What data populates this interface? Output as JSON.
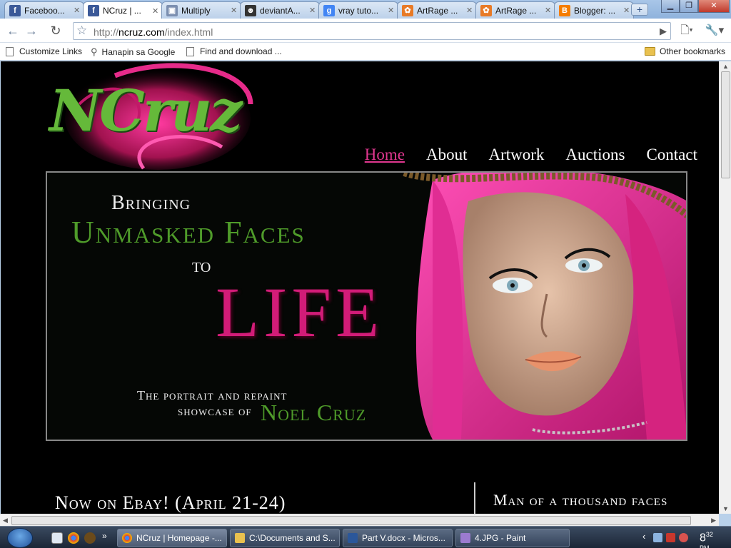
{
  "browser": {
    "tabs": [
      {
        "title": "Faceboo...",
        "icon": "facebook-icon",
        "active": false
      },
      {
        "title": "NCruz | ...",
        "icon": "facebook-icon",
        "active": true
      },
      {
        "title": "Multiply",
        "icon": "multiply-icon",
        "active": false
      },
      {
        "title": "deviantA...",
        "icon": "deviantart-icon",
        "active": false
      },
      {
        "title": "vray tuto...",
        "icon": "google-icon",
        "active": false
      },
      {
        "title": "ArtRage ...",
        "icon": "artrage-icon",
        "active": false
      },
      {
        "title": "ArtRage ...",
        "icon": "artrage-icon",
        "active": false
      },
      {
        "title": "Blogger: ...",
        "icon": "blogger-icon",
        "active": false
      }
    ],
    "url_prefix": "http://",
    "url_domain": "ncruz.com",
    "url_path": "/index.html",
    "bookmarks": [
      {
        "label": "Customize Links",
        "icon": "page-icon"
      },
      {
        "label": "Hanapin sa Google",
        "icon": "search-icon"
      },
      {
        "label": "Find and download ...",
        "icon": "page-icon"
      }
    ],
    "other_bookmarks": "Other bookmarks"
  },
  "page": {
    "logo": "NCruz",
    "nav": [
      {
        "label": "Home",
        "active": true
      },
      {
        "label": "About",
        "active": false
      },
      {
        "label": "Artwork",
        "active": false
      },
      {
        "label": "Auctions",
        "active": false
      },
      {
        "label": "Contact",
        "active": false
      }
    ],
    "banner": {
      "line1": "Bringing",
      "line2": "Unmasked Faces",
      "line3": "to",
      "line4": "LIFE",
      "line5": "The portrait and repaint",
      "line6": "showcase of",
      "line7": "Noel Cruz"
    },
    "section_left": "Now on Ebay! (April 21-24)",
    "section_right": "Man of a thousand faces"
  },
  "taskbar": {
    "tasks": [
      {
        "label": "NCruz | Homepage -...",
        "icon": "chrome-icon"
      },
      {
        "label": "C:\\Documents and S...",
        "icon": "folder-icon"
      },
      {
        "label": "Part V.docx - Micros...",
        "icon": "word-icon"
      },
      {
        "label": "4.JPG - Paint",
        "icon": "paint-icon"
      }
    ],
    "clock_hour": "8",
    "clock_min": "32",
    "clock_ampm": "PM"
  },
  "colors": {
    "accent_pink": "#d21c78",
    "accent_green": "#4f9b2a",
    "page_bg": "#000000"
  }
}
